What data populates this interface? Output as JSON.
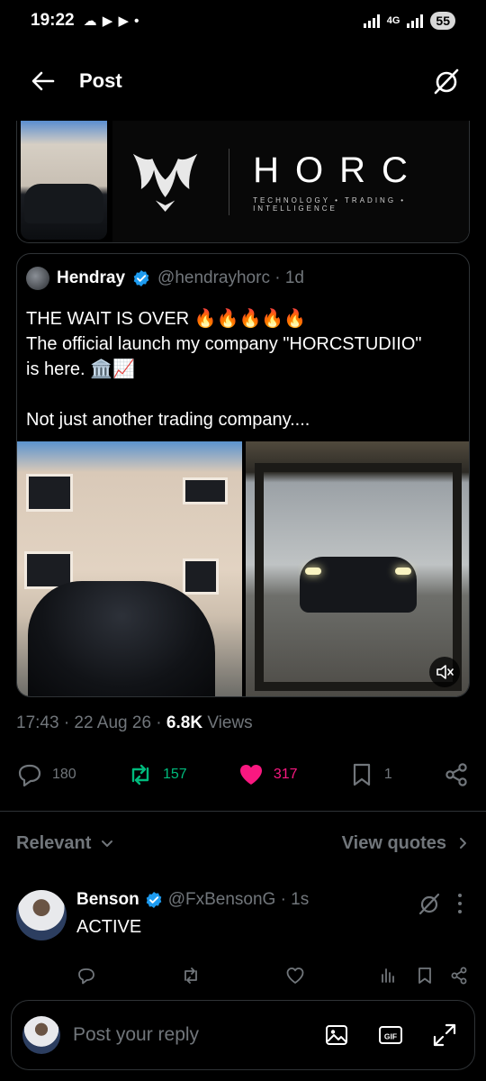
{
  "status_bar": {
    "time": "19:22",
    "battery": "55",
    "network": "4G"
  },
  "header": {
    "title": "Post"
  },
  "top_media": {
    "logo_word": "HORC",
    "logo_tagline": "TECHNOLOGY • TRADING • INTELLIGENCE"
  },
  "quote": {
    "name": "Hendray",
    "handle_time": "@hendrayhorc · 1d",
    "lines": [
      "THE WAIT IS OVER 🔥🔥🔥🔥🔥",
      "The official launch my company  \"HORCSTUDIIO\"",
      "is here. 🏛️📈",
      "",
      "Not just another trading company...."
    ]
  },
  "meta": {
    "timestamp": "17:43 · 22 Aug 26 · ",
    "views_count": "6.8K",
    "views_label": " Views"
  },
  "actions": {
    "replies": "180",
    "reposts": "157",
    "likes": "317",
    "bookmarks": "1"
  },
  "colors": {
    "repost_green": "#00ba7c",
    "like_pink": "#f91880",
    "verified_blue": "#1d9bf0",
    "muted_gray": "#71767b"
  },
  "filter": {
    "relevant_label": "Relevant",
    "view_quotes_label": "View quotes"
  },
  "reply": {
    "name": "Benson",
    "handle_time": "@FxBensonG · 1s",
    "text": "ACTIVE"
  },
  "composer": {
    "placeholder": "Post your reply",
    "gif_label": "GIF"
  }
}
